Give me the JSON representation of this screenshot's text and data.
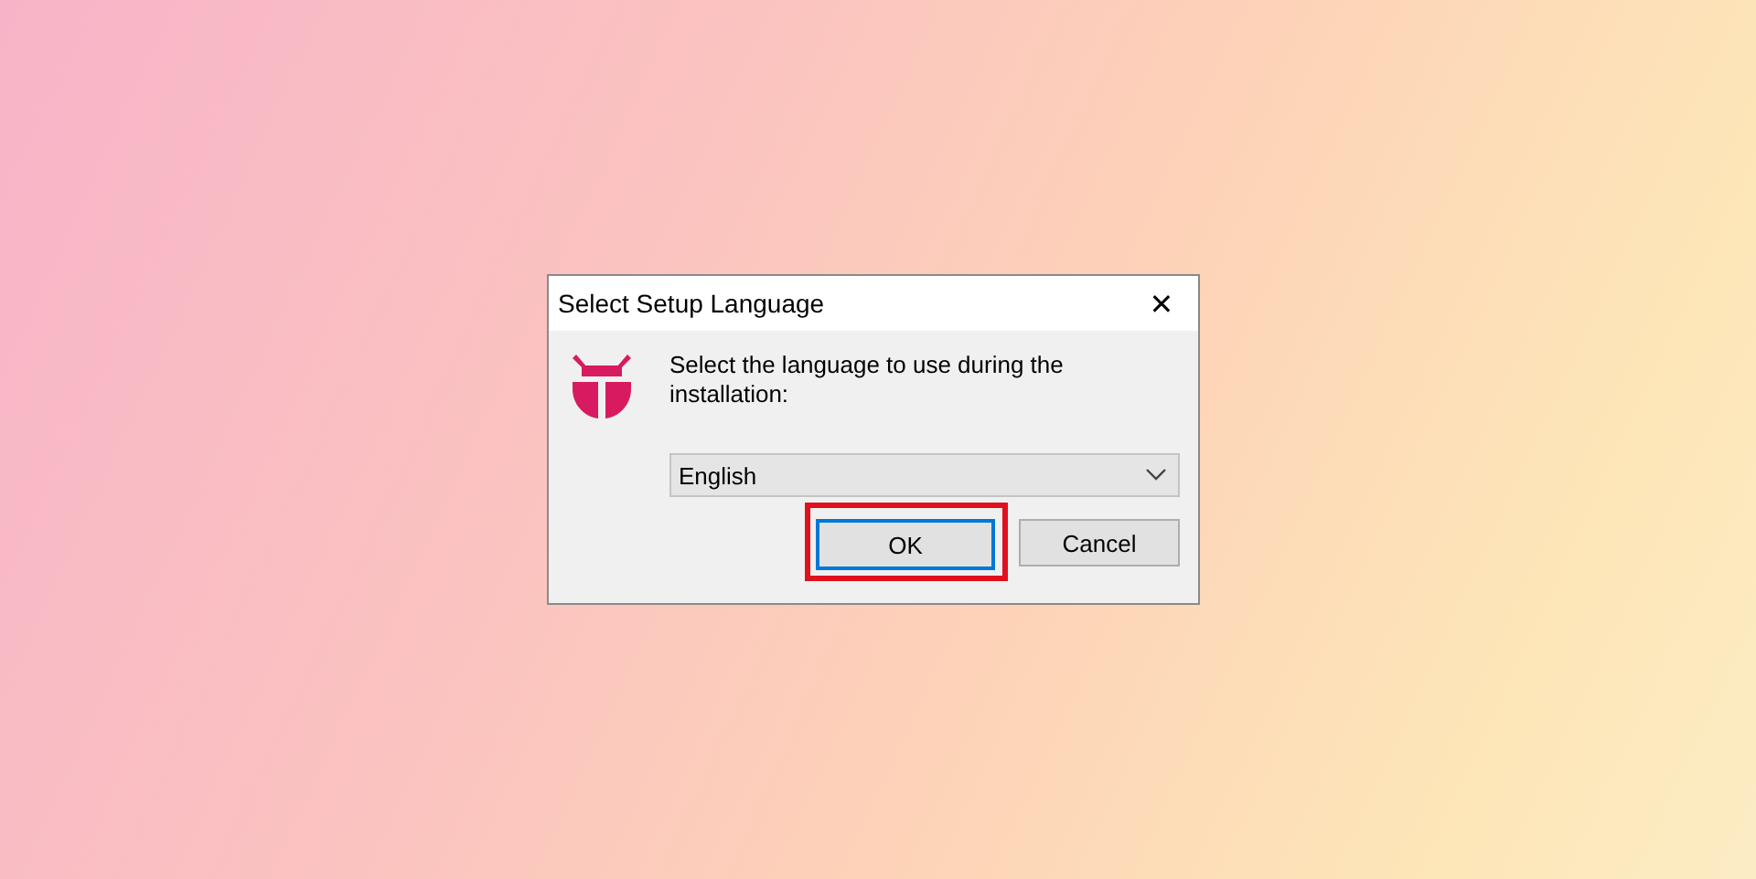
{
  "window": {
    "title": "Select Setup Language",
    "close": "✕"
  },
  "message": "Select the language to use during the installation:",
  "language_dropdown": {
    "value": "English"
  },
  "buttons": [
    {
      "label": "OK",
      "default": true,
      "highlighted": true
    },
    {
      "label": "Cancel",
      "default": false,
      "highlighted": false
    }
  ]
}
